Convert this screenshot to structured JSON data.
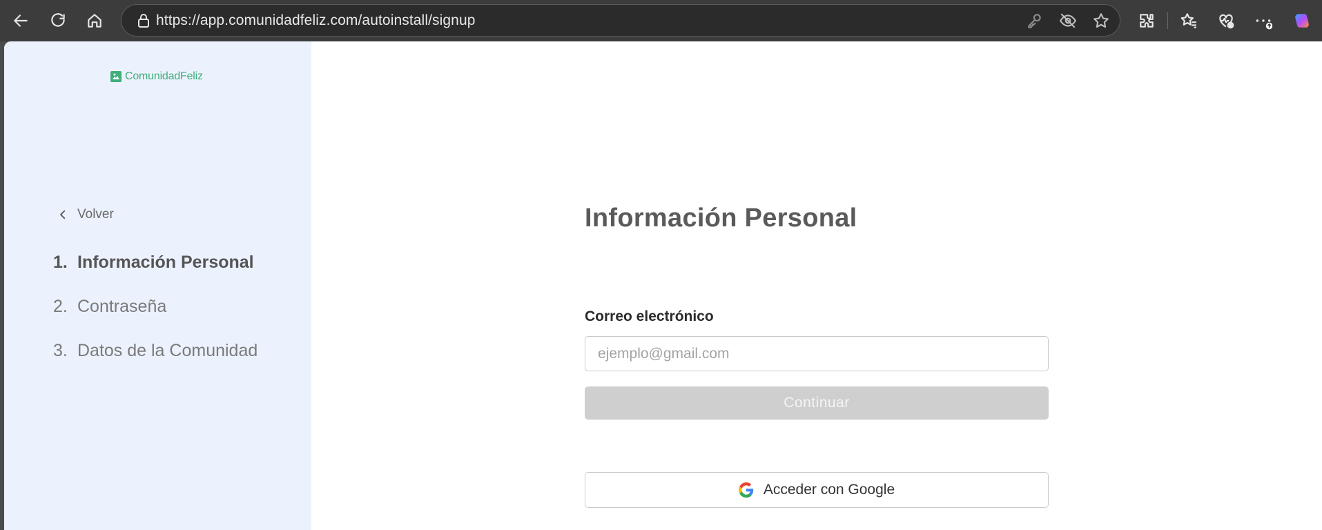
{
  "browser": {
    "url": "https://app.comunidadfeliz.com/autoinstall/signup",
    "icons": [
      "back-icon",
      "refresh-icon",
      "home-icon",
      "lock-icon",
      "key-icon",
      "eye-off-icon",
      "star-icon",
      "extensions-icon",
      "favorites-icon",
      "health-icon",
      "more-icon",
      "copilot-icon"
    ],
    "badge_color": "#ffffff"
  },
  "sidebar": {
    "logo_text": "ComunidadFeliz",
    "back_label": "Volver",
    "steps": [
      {
        "num": "1.",
        "label": "Información Personal",
        "active": true
      },
      {
        "num": "2.",
        "label": "Contraseña",
        "active": false
      },
      {
        "num": "3.",
        "label": "Datos de la Comunidad",
        "active": false
      }
    ]
  },
  "main": {
    "title": "Información Personal",
    "email_label": "Correo electrónico",
    "email_placeholder": "ejemplo@gmail.com",
    "email_value": "",
    "continue_label": "Continuar",
    "google_label": "Acceder con Google"
  },
  "colors": {
    "brand_green": "#3fae7b",
    "sidebar_bg": "#ecf2fd",
    "disabled_button": "#cfcfcf"
  }
}
